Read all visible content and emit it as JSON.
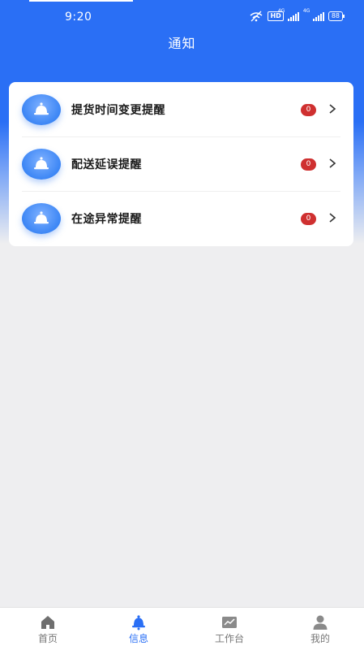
{
  "status_bar": {
    "time": "9:20",
    "hd": "HD",
    "network_1": "4G",
    "network_2": "4G",
    "battery": "88"
  },
  "header": {
    "title": "通知"
  },
  "notifications": [
    {
      "label": "提货时间变更提醒",
      "count": "0",
      "icon": "bell-icon"
    },
    {
      "label": "配送延误提醒",
      "count": "0",
      "icon": "bell-icon"
    },
    {
      "label": "在途异常提醒",
      "count": "0",
      "icon": "bell-icon"
    }
  ],
  "tabbar": {
    "items": [
      {
        "label": "首页",
        "icon": "home-icon",
        "active": false
      },
      {
        "label": "信息",
        "icon": "bell-icon",
        "active": true
      },
      {
        "label": "工作台",
        "icon": "chart-icon",
        "active": false
      },
      {
        "label": "我的",
        "icon": "user-icon",
        "active": false
      }
    ]
  },
  "colors": {
    "primary": "#2a6ff5",
    "badge": "#cf3030",
    "background": "#eeeef0"
  }
}
